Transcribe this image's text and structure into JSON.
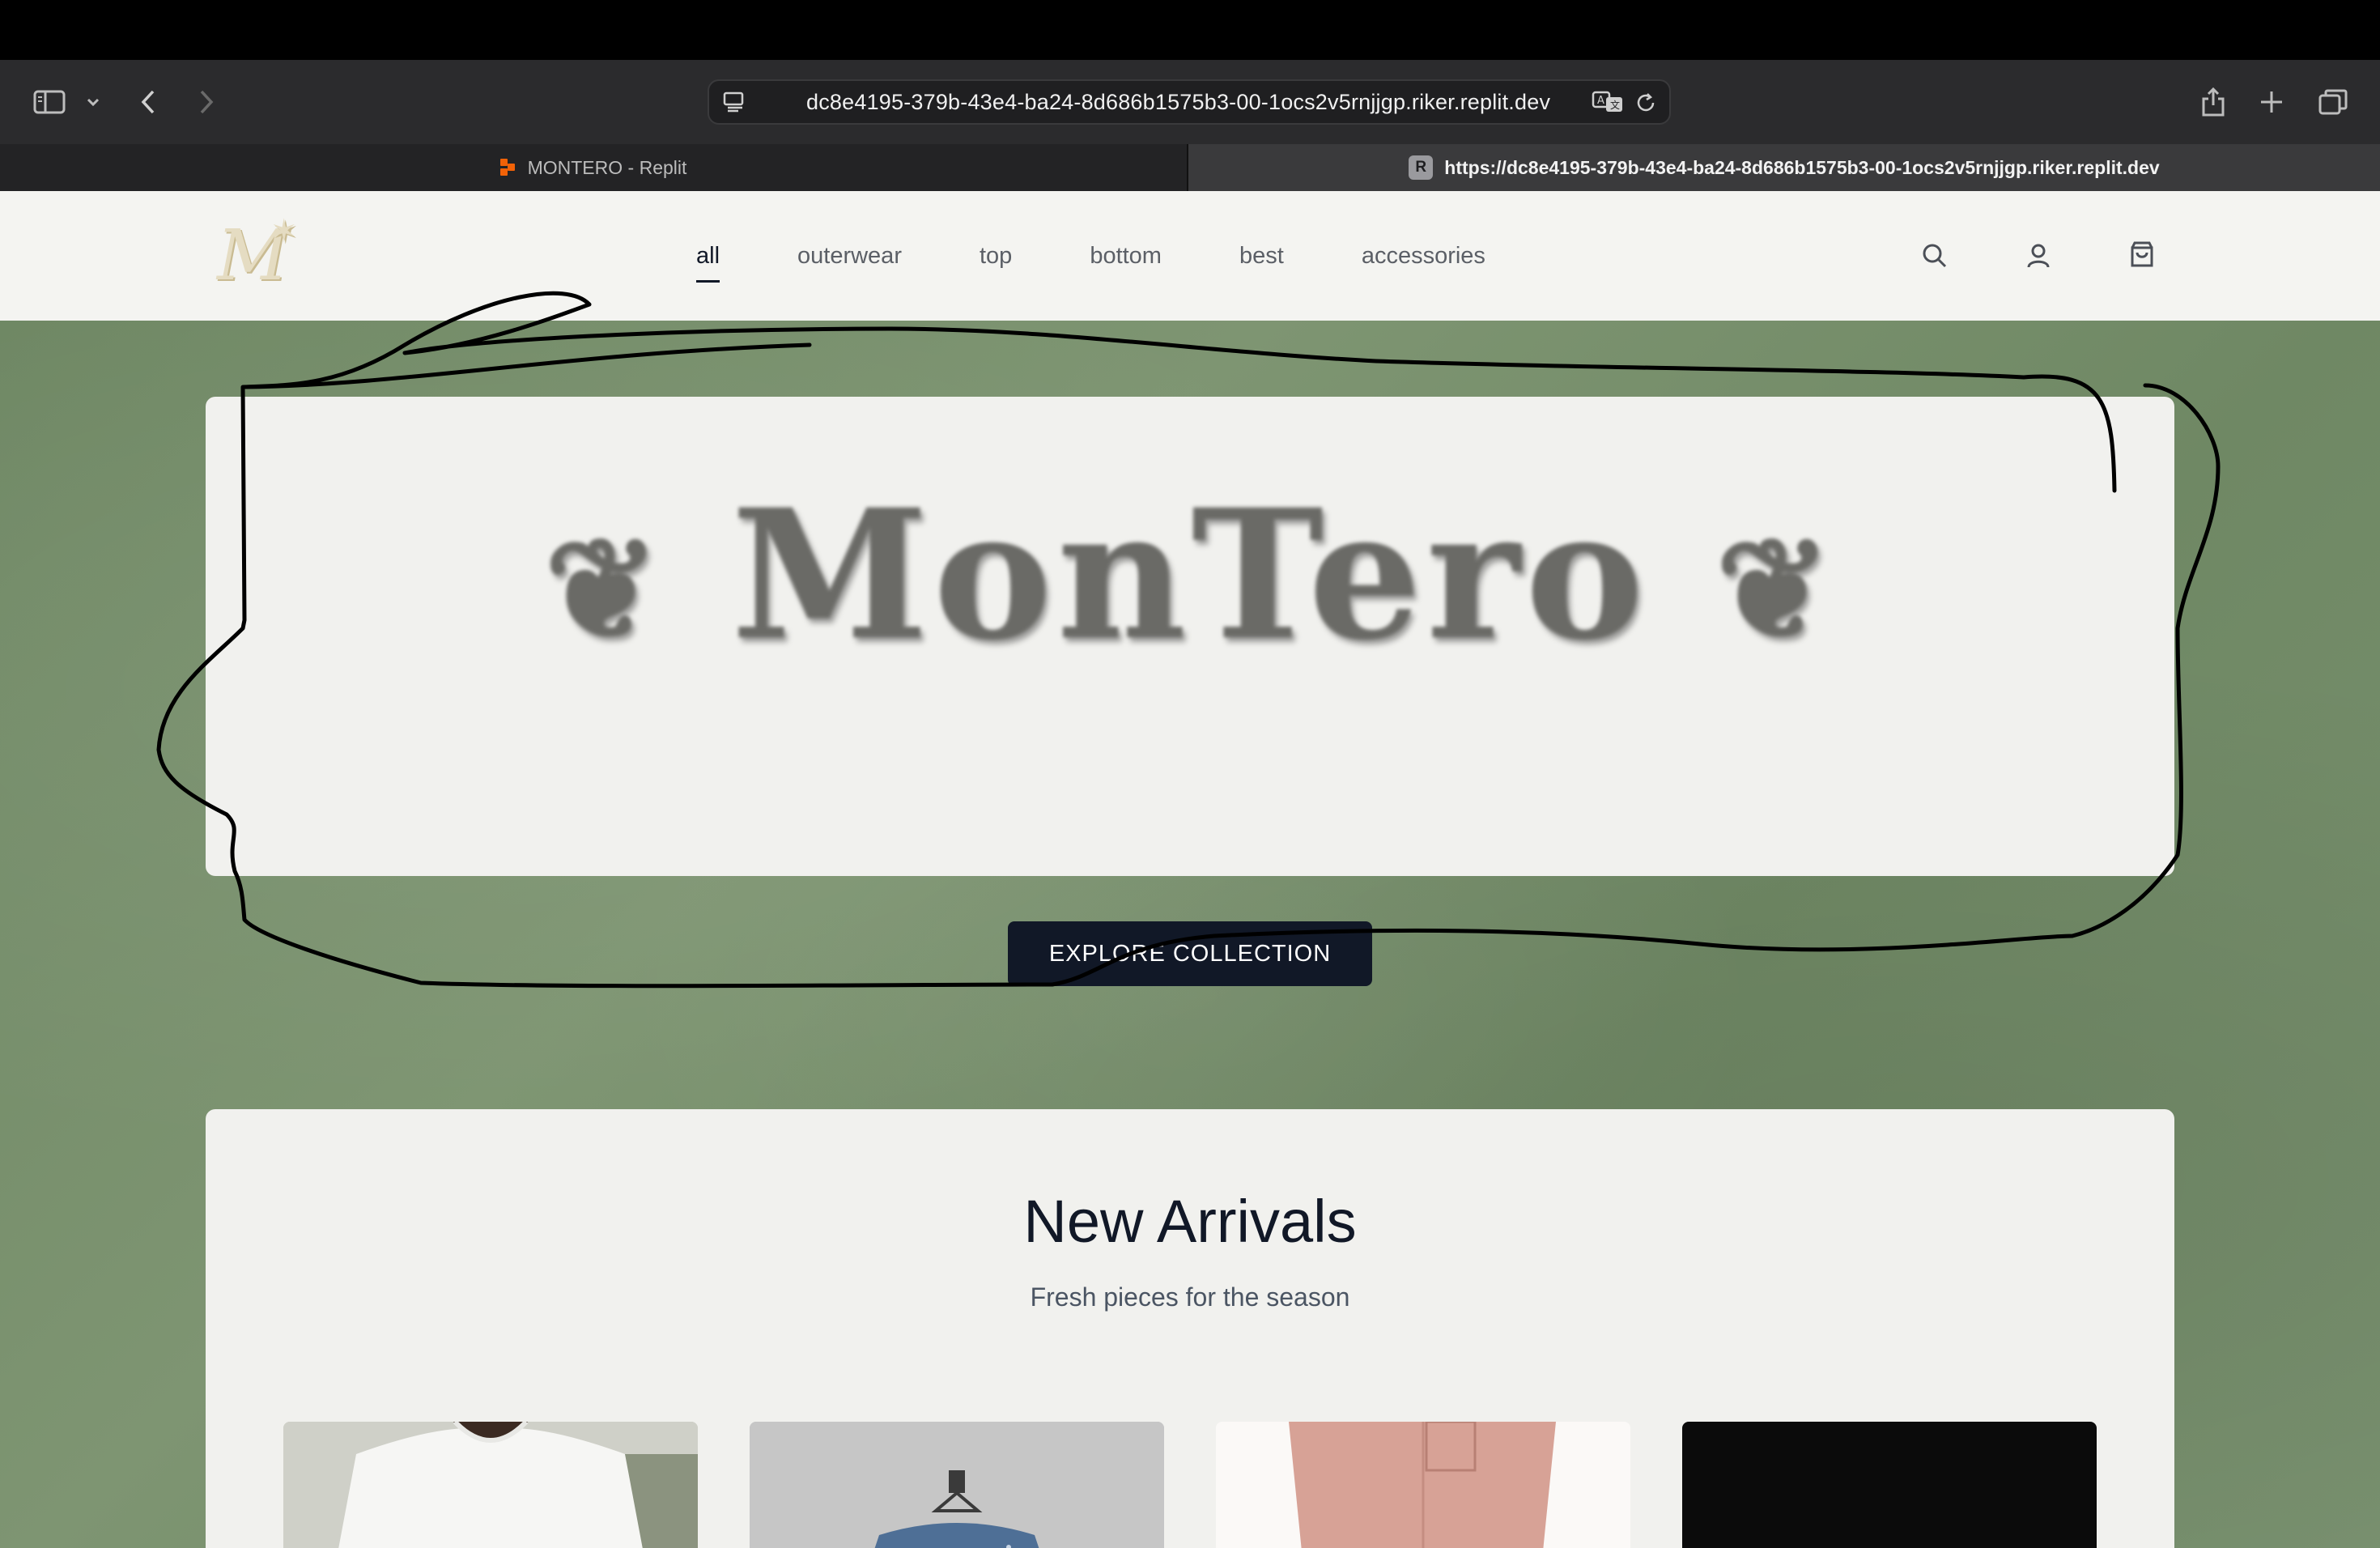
{
  "browser": {
    "url": "dc8e4195-379b-43e4-ba24-8d686b1575b3-00-1ocs2v5rnjjgp.riker.replit.dev",
    "tabs": [
      {
        "title": "MONTERO - Replit",
        "active": false
      },
      {
        "title": "https://dc8e4195-379b-43e4-ba24-8d686b1575b3-00-1ocs2v5rnjjgp.riker.replit.dev",
        "active": true
      }
    ],
    "r_favicon": "R"
  },
  "site": {
    "logo": "M",
    "nav": [
      "all",
      "outerwear",
      "top",
      "bottom",
      "best",
      "accessories"
    ],
    "active_nav": "all",
    "hero": {
      "title": "MonTero",
      "ornament_left": "❦",
      "ornament_right": "❦",
      "cta": "EXPLORE COLLECTION"
    },
    "arrivals": {
      "title": "New Arrivals",
      "subtitle": "Fresh pieces for the season"
    },
    "colors": {
      "accent": "#111827",
      "background_green": "#768f6b",
      "card": "#f1f1ee"
    }
  }
}
